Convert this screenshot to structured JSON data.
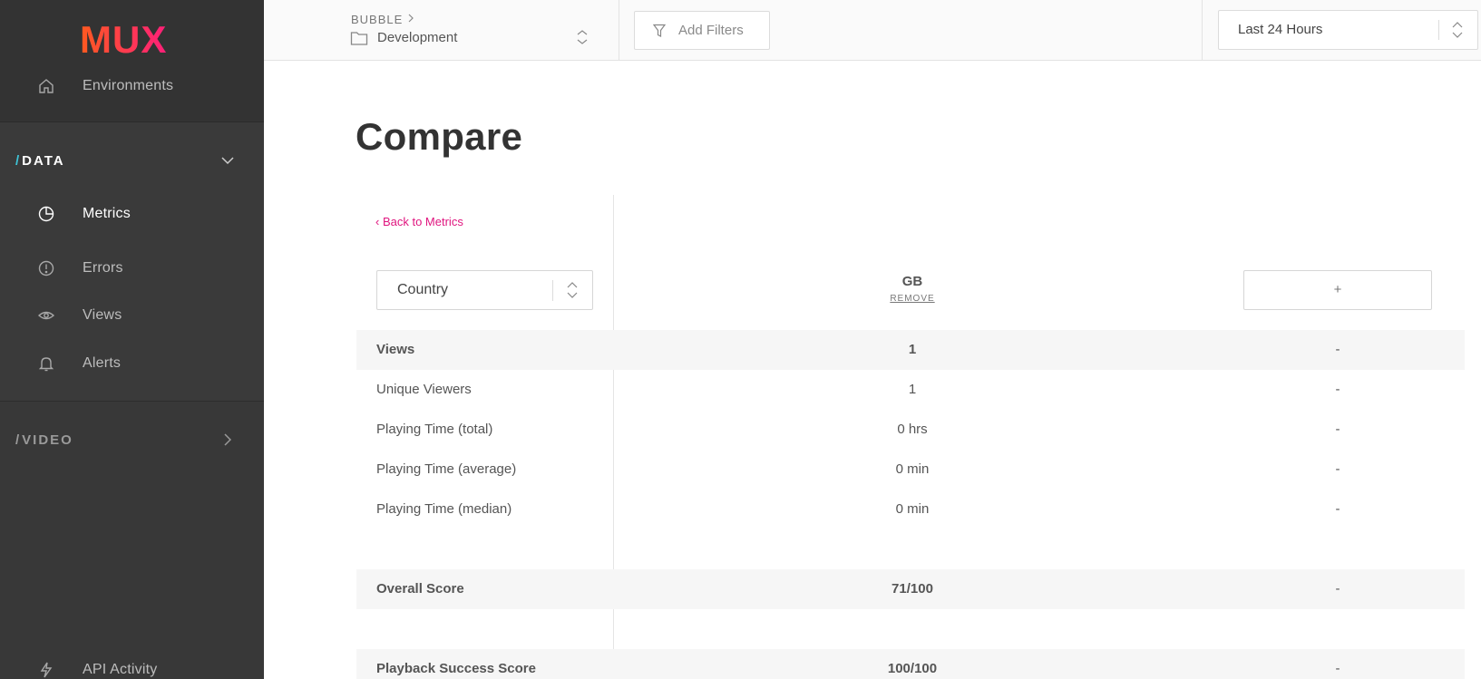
{
  "sidebar": {
    "logo_text": "MUX",
    "environments_label": "Environments",
    "data_section": {
      "slash": "/",
      "title": "DATA"
    },
    "items": [
      {
        "label": "Metrics"
      },
      {
        "label": "Errors"
      },
      {
        "label": "Views"
      },
      {
        "label": "Alerts"
      }
    ],
    "video_section": {
      "slash": "/",
      "title": "VIDEO"
    },
    "api_activity_label": "API Activity"
  },
  "topbar": {
    "org": "BUBBLE",
    "environment": "Development",
    "filters_label": "Add Filters",
    "time_range": "Last 24 Hours"
  },
  "main": {
    "title": "Compare",
    "back_link": "Back to Metrics",
    "back_chevron": "‹",
    "dimension": "Country",
    "column": {
      "name": "GB",
      "remove_label": "REMOVE"
    },
    "add_column_label": "+",
    "rows": [
      {
        "label": "Views",
        "value": "1",
        "other": "-"
      },
      {
        "label": "Unique Viewers",
        "value": "1",
        "other": "-"
      },
      {
        "label": "Playing Time (total)",
        "value": "0 hrs",
        "other": "-"
      },
      {
        "label": "Playing Time (average)",
        "value": "0 min",
        "other": "-"
      },
      {
        "label": "Playing Time (median)",
        "value": "0 min",
        "other": "-"
      },
      {
        "label": "Overall Score",
        "value": "71/100",
        "other": "-"
      },
      {
        "label": "Playback Success Score",
        "value": "100/100",
        "other": "-"
      }
    ]
  },
  "colors": {
    "sidebar_bg": "#383838",
    "accent_pink": "#e0157f",
    "accent_cyan": "#3ec3d6",
    "logo_gradient": [
      "#ff5a1f",
      "#ff1f7a"
    ]
  }
}
